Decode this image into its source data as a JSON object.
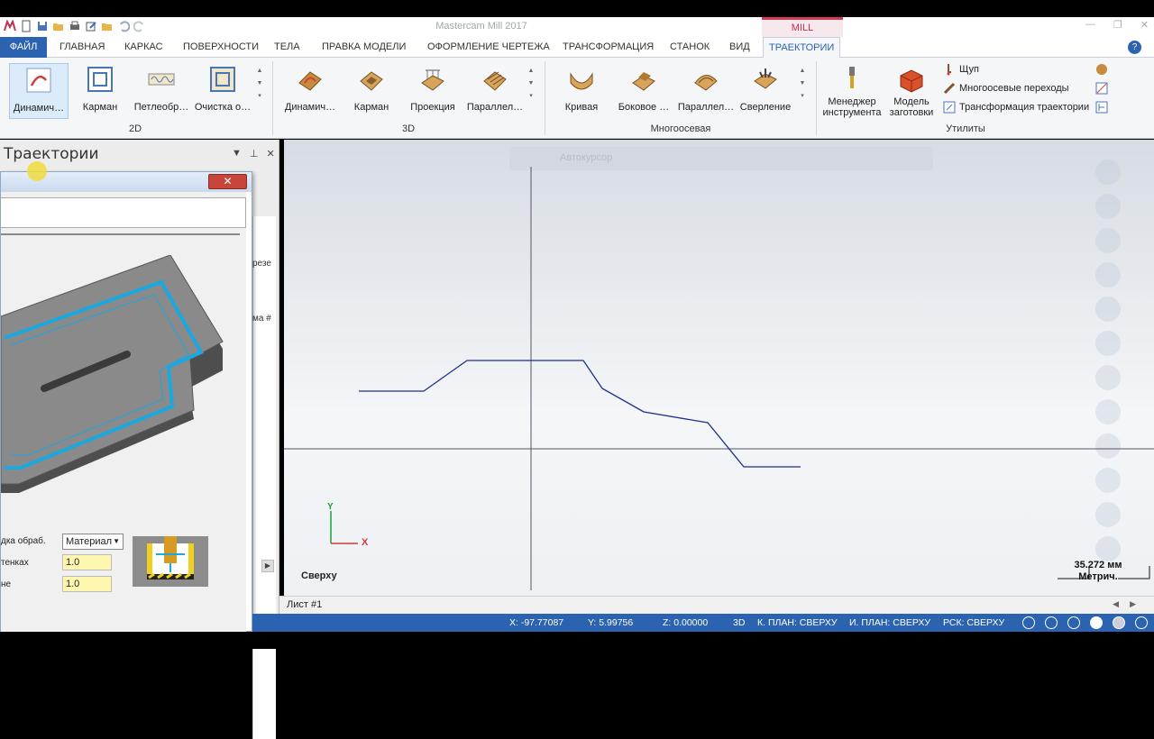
{
  "app": {
    "title": "Mastercam Mill 2017",
    "context_tab": "MILL"
  },
  "tabs": [
    {
      "label": "ФАЙЛ"
    },
    {
      "label": "ГЛАВНАЯ"
    },
    {
      "label": "КАРКАС"
    },
    {
      "label": "ПОВЕРХНОСТИ"
    },
    {
      "label": "ТЕЛА"
    },
    {
      "label": "ПРАВКА МОДЕЛИ"
    },
    {
      "label": "ОФОРМЛЕНИЕ ЧЕРТЕЖА"
    },
    {
      "label": "ТРАНСФОРМАЦИЯ"
    },
    {
      "label": "СТАНОК"
    },
    {
      "label": "ВИД"
    },
    {
      "label": "ТРАЕКТОРИИ"
    }
  ],
  "ribbon": {
    "group_2d": {
      "label": "2D",
      "buttons": [
        "Динамич…",
        "Карман",
        "Петлеобр…",
        "Очистка о…"
      ]
    },
    "group_3d": {
      "label": "3D",
      "buttons": [
        "Динамич…",
        "Карман",
        "Проекция",
        "Параллел…"
      ]
    },
    "group_multi": {
      "label": "Многоосевая",
      "buttons": [
        "Кривая",
        "Боковое …",
        "Параллел…",
        "Сверление"
      ]
    },
    "group_util": {
      "label": "Утилиты",
      "tool_manager_1": "Менеджер",
      "tool_manager_2": "инструмента",
      "stock_model_1": "Модель",
      "stock_model_2": "заготовки",
      "probe": "Щуп",
      "multiaxis_linking": "Многоосевые переходы",
      "toolpath_transform": "Трансформация траектории"
    }
  },
  "panel": {
    "title": "Траектории",
    "side_text_1": "резе",
    "side_text_2": "ма #"
  },
  "dialog": {
    "close": "✕",
    "stock_label": "дка обраб.",
    "stock_value": "Материал",
    "walls_label": "тенках",
    "walls_value": "1.0",
    "floor_label": "не",
    "floor_value": "1.0"
  },
  "viewport": {
    "autocursor": "Автокурсор",
    "view_name": "Сверху",
    "axis_x": "X",
    "axis_y": "Y",
    "scale_value": "35.272 мм",
    "scale_unit": "Метрич."
  },
  "sheet": {
    "tab": "Лист #1"
  },
  "status": {
    "x": "X:  -97.77087",
    "y": "Y:  5.99756",
    "z": "Z:  0.00000",
    "mode": "3D",
    "cplane": "К. ПЛАН: СВЕРХУ",
    "tplane": "И. ПЛАН: СВЕРХУ",
    "wcs": "РСК: СВЕРХУ"
  },
  "colors": {
    "accent": "#2b63b0",
    "context": "#c0304f",
    "toolpath": "#1aa8e0",
    "geometry": "#1f2f8a"
  }
}
